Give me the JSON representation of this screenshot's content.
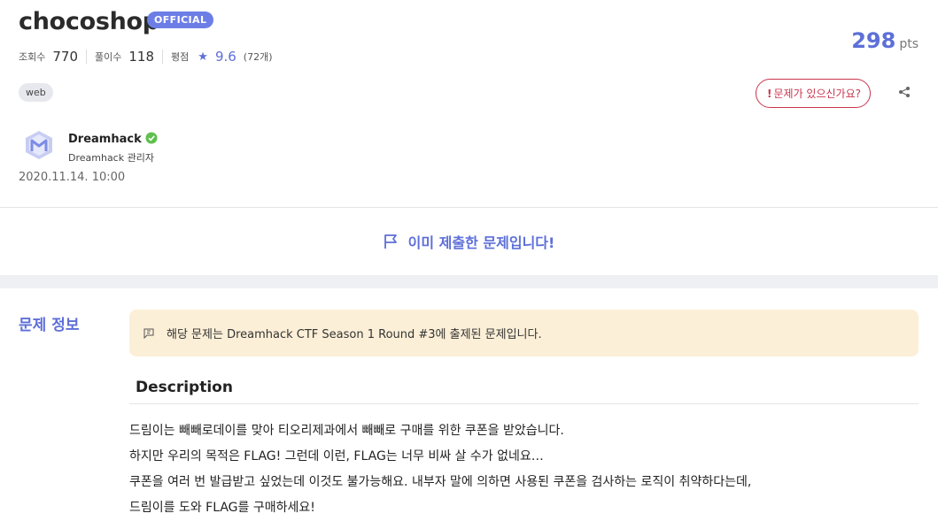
{
  "challenge": {
    "title": "chocoshop",
    "badge": "OFFICIAL",
    "points": "298",
    "points_unit": "pts",
    "stats": {
      "views_label": "조회수",
      "views": "770",
      "solves_label": "풀이수",
      "solves": "118",
      "rating_label": "평점",
      "rating": "9.6",
      "rating_count": "(72개)"
    },
    "tag": "web",
    "report_label": "문제가 있으신가요?",
    "report_icon": "!"
  },
  "author": {
    "name": "Dreamhack",
    "role": "Dreamhack 관리자",
    "date": "2020.11.14. 10:00",
    "verified_color": "#4caf50"
  },
  "status": {
    "submitted_text": "이미 제출한 문제입니다!"
  },
  "info": {
    "section_label": "문제 정보",
    "notice": "해당 문제는 Dreamhack CTF Season 1 Round #3에 출제된 문제입니다.",
    "description_title": "Description",
    "description_lines": [
      "드림이는 빼빼로데이를 맞아 티오리제과에서 빼빼로 구매를 위한 쿠폰을 받았습니다.",
      "하지만 우리의 목적은 FLAG! 그런데 이런, FLAG는 너무 비싸 살 수가 없네요…",
      "쿠폰을 여러 번 발급받고 싶었는데 이것도 불가능해요. 내부자 말에 의하면 사용된 쿠폰을 검사하는 로직이 취약하다는데,",
      "드림이를 도와 FLAG를 구매하세요!"
    ]
  },
  "colors": {
    "accent": "#5d6fd8",
    "badge": "#6c7ee6",
    "report": "#c9344c",
    "notice_bg": "#fcefd7"
  }
}
